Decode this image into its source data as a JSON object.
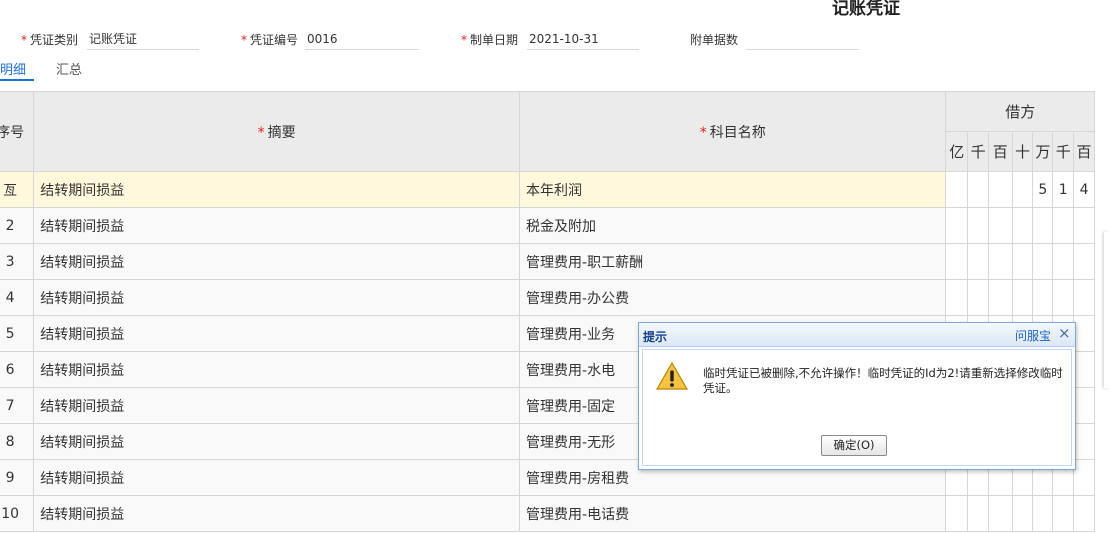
{
  "title": "记账凭证",
  "header": {
    "fields": [
      {
        "label": "凭证类别",
        "required": true,
        "value": "记账凭证"
      },
      {
        "label": "凭证编号",
        "required": true,
        "value": "0016"
      },
      {
        "label": "制单日期",
        "required": true,
        "value": "2021-10-31"
      },
      {
        "label": "附单据数",
        "required": false,
        "value": ""
      }
    ]
  },
  "tabs": [
    {
      "label": "明细",
      "active": true
    },
    {
      "label": "汇总",
      "active": false
    }
  ],
  "table": {
    "columns": {
      "seq": "序号",
      "summary": "摘要",
      "account": "科目名称",
      "debit": "借方"
    },
    "required_mark": "*",
    "units": [
      "亿",
      "千",
      "百",
      "十",
      "万",
      "千",
      "百"
    ],
    "rows": [
      {
        "seq": "亙",
        "summary": "结转期间损益",
        "account": "本年利润",
        "debit_digits": [
          "",
          "",
          "",
          "",
          "5",
          "1",
          "4"
        ],
        "current": true
      },
      {
        "seq": "2",
        "summary": "结转期间损益",
        "account": "税金及附加",
        "debit_digits": [
          "",
          "",
          "",
          "",
          "",
          "",
          ""
        ]
      },
      {
        "seq": "3",
        "summary": "结转期间损益",
        "account": "管理费用-职工薪酬",
        "debit_digits": [
          "",
          "",
          "",
          "",
          "",
          "",
          ""
        ]
      },
      {
        "seq": "4",
        "summary": "结转期间损益",
        "account": "管理费用-办公费",
        "debit_digits": [
          "",
          "",
          "",
          "",
          "",
          "",
          ""
        ]
      },
      {
        "seq": "5",
        "summary": "结转期间损益",
        "account": "管理费用-业务",
        "debit_digits": [
          "",
          "",
          "",
          "",
          "",
          "",
          ""
        ]
      },
      {
        "seq": "6",
        "summary": "结转期间损益",
        "account": "管理费用-水电",
        "debit_digits": [
          "",
          "",
          "",
          "",
          "",
          "",
          ""
        ]
      },
      {
        "seq": "7",
        "summary": "结转期间损益",
        "account": "管理费用-固定",
        "debit_digits": [
          "",
          "",
          "",
          "",
          "",
          "",
          ""
        ]
      },
      {
        "seq": "8",
        "summary": "结转期间损益",
        "account": "管理费用-无形",
        "debit_digits": [
          "",
          "",
          "",
          "",
          "",
          "",
          ""
        ]
      },
      {
        "seq": "9",
        "summary": "结转期间损益",
        "account": "管理费用-房租费",
        "debit_digits": [
          "",
          "",
          "",
          "",
          "",
          "",
          ""
        ]
      },
      {
        "seq": "10",
        "summary": "结转期间损益",
        "account": "管理费用-电话费",
        "debit_digits": [
          "",
          "",
          "",
          "",
          "",
          "",
          ""
        ]
      }
    ]
  },
  "dialog": {
    "title": "提示",
    "help_link": "问服宝",
    "close_symbol": "×",
    "icon": "warning-icon",
    "message": "临时凭证已被删除,不允许操作！临时凭证的Id为2!请重新选择修改临时凭证。",
    "ok_label": "确定(O)"
  },
  "colors": {
    "accent": "#1e6fd9",
    "required": "#e02020",
    "current_row": "#fff8dc",
    "header_bg": "#ebebeb",
    "dialog_border": "#7ea7d8"
  }
}
